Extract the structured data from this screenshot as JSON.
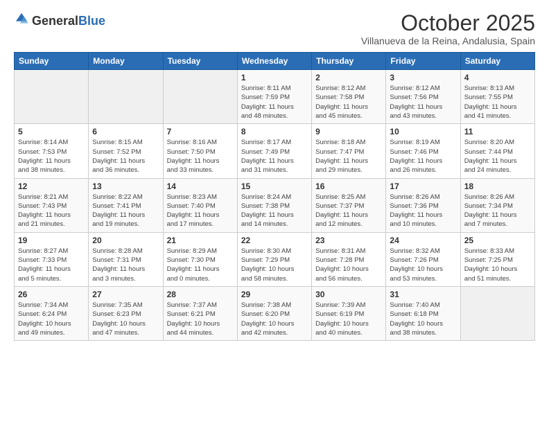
{
  "header": {
    "logo_general": "General",
    "logo_blue": "Blue",
    "title": "October 2025",
    "subtitle": "Villanueva de la Reina, Andalusia, Spain"
  },
  "weekdays": [
    "Sunday",
    "Monday",
    "Tuesday",
    "Wednesday",
    "Thursday",
    "Friday",
    "Saturday"
  ],
  "weeks": [
    [
      {
        "day": "",
        "info": ""
      },
      {
        "day": "",
        "info": ""
      },
      {
        "day": "",
        "info": ""
      },
      {
        "day": "1",
        "info": "Sunrise: 8:11 AM\nSunset: 7:59 PM\nDaylight: 11 hours\nand 48 minutes."
      },
      {
        "day": "2",
        "info": "Sunrise: 8:12 AM\nSunset: 7:58 PM\nDaylight: 11 hours\nand 45 minutes."
      },
      {
        "day": "3",
        "info": "Sunrise: 8:12 AM\nSunset: 7:56 PM\nDaylight: 11 hours\nand 43 minutes."
      },
      {
        "day": "4",
        "info": "Sunrise: 8:13 AM\nSunset: 7:55 PM\nDaylight: 11 hours\nand 41 minutes."
      }
    ],
    [
      {
        "day": "5",
        "info": "Sunrise: 8:14 AM\nSunset: 7:53 PM\nDaylight: 11 hours\nand 38 minutes."
      },
      {
        "day": "6",
        "info": "Sunrise: 8:15 AM\nSunset: 7:52 PM\nDaylight: 11 hours\nand 36 minutes."
      },
      {
        "day": "7",
        "info": "Sunrise: 8:16 AM\nSunset: 7:50 PM\nDaylight: 11 hours\nand 33 minutes."
      },
      {
        "day": "8",
        "info": "Sunrise: 8:17 AM\nSunset: 7:49 PM\nDaylight: 11 hours\nand 31 minutes."
      },
      {
        "day": "9",
        "info": "Sunrise: 8:18 AM\nSunset: 7:47 PM\nDaylight: 11 hours\nand 29 minutes."
      },
      {
        "day": "10",
        "info": "Sunrise: 8:19 AM\nSunset: 7:46 PM\nDaylight: 11 hours\nand 26 minutes."
      },
      {
        "day": "11",
        "info": "Sunrise: 8:20 AM\nSunset: 7:44 PM\nDaylight: 11 hours\nand 24 minutes."
      }
    ],
    [
      {
        "day": "12",
        "info": "Sunrise: 8:21 AM\nSunset: 7:43 PM\nDaylight: 11 hours\nand 21 minutes."
      },
      {
        "day": "13",
        "info": "Sunrise: 8:22 AM\nSunset: 7:41 PM\nDaylight: 11 hours\nand 19 minutes."
      },
      {
        "day": "14",
        "info": "Sunrise: 8:23 AM\nSunset: 7:40 PM\nDaylight: 11 hours\nand 17 minutes."
      },
      {
        "day": "15",
        "info": "Sunrise: 8:24 AM\nSunset: 7:38 PM\nDaylight: 11 hours\nand 14 minutes."
      },
      {
        "day": "16",
        "info": "Sunrise: 8:25 AM\nSunset: 7:37 PM\nDaylight: 11 hours\nand 12 minutes."
      },
      {
        "day": "17",
        "info": "Sunrise: 8:26 AM\nSunset: 7:36 PM\nDaylight: 11 hours\nand 10 minutes."
      },
      {
        "day": "18",
        "info": "Sunrise: 8:26 AM\nSunset: 7:34 PM\nDaylight: 11 hours\nand 7 minutes."
      }
    ],
    [
      {
        "day": "19",
        "info": "Sunrise: 8:27 AM\nSunset: 7:33 PM\nDaylight: 11 hours\nand 5 minutes."
      },
      {
        "day": "20",
        "info": "Sunrise: 8:28 AM\nSunset: 7:31 PM\nDaylight: 11 hours\nand 3 minutes."
      },
      {
        "day": "21",
        "info": "Sunrise: 8:29 AM\nSunset: 7:30 PM\nDaylight: 11 hours\nand 0 minutes."
      },
      {
        "day": "22",
        "info": "Sunrise: 8:30 AM\nSunset: 7:29 PM\nDaylight: 10 hours\nand 58 minutes."
      },
      {
        "day": "23",
        "info": "Sunrise: 8:31 AM\nSunset: 7:28 PM\nDaylight: 10 hours\nand 56 minutes."
      },
      {
        "day": "24",
        "info": "Sunrise: 8:32 AM\nSunset: 7:26 PM\nDaylight: 10 hours\nand 53 minutes."
      },
      {
        "day": "25",
        "info": "Sunrise: 8:33 AM\nSunset: 7:25 PM\nDaylight: 10 hours\nand 51 minutes."
      }
    ],
    [
      {
        "day": "26",
        "info": "Sunrise: 7:34 AM\nSunset: 6:24 PM\nDaylight: 10 hours\nand 49 minutes."
      },
      {
        "day": "27",
        "info": "Sunrise: 7:35 AM\nSunset: 6:23 PM\nDaylight: 10 hours\nand 47 minutes."
      },
      {
        "day": "28",
        "info": "Sunrise: 7:37 AM\nSunset: 6:21 PM\nDaylight: 10 hours\nand 44 minutes."
      },
      {
        "day": "29",
        "info": "Sunrise: 7:38 AM\nSunset: 6:20 PM\nDaylight: 10 hours\nand 42 minutes."
      },
      {
        "day": "30",
        "info": "Sunrise: 7:39 AM\nSunset: 6:19 PM\nDaylight: 10 hours\nand 40 minutes."
      },
      {
        "day": "31",
        "info": "Sunrise: 7:40 AM\nSunset: 6:18 PM\nDaylight: 10 hours\nand 38 minutes."
      },
      {
        "day": "",
        "info": ""
      }
    ]
  ]
}
